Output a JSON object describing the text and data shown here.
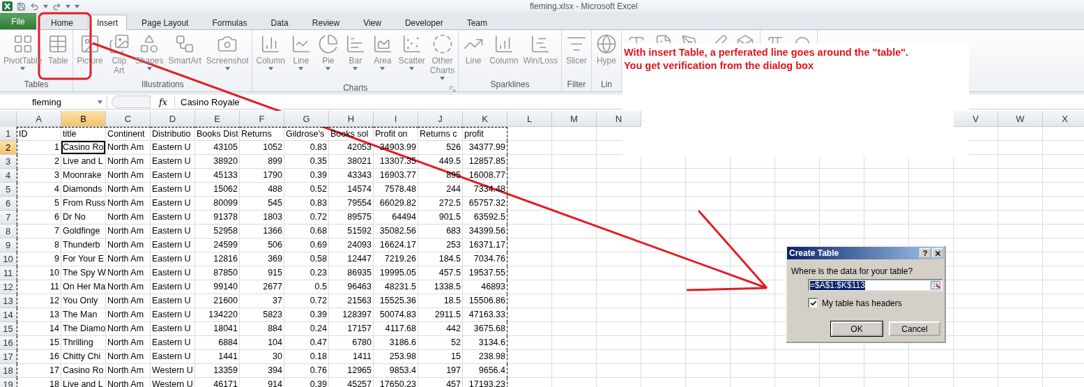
{
  "window": {
    "title": "fleming.xlsx  -  Microsoft Excel"
  },
  "tabs": [
    {
      "label": "File",
      "kind": "file",
      "selected": false
    },
    {
      "label": "Home",
      "kind": "tab",
      "selected": false
    },
    {
      "label": "Insert",
      "kind": "tab",
      "selected": true
    },
    {
      "label": "Page Layout",
      "kind": "tab",
      "selected": false
    },
    {
      "label": "Formulas",
      "kind": "tab",
      "selected": false
    },
    {
      "label": "Data",
      "kind": "tab",
      "selected": false
    },
    {
      "label": "Review",
      "kind": "tab",
      "selected": false
    },
    {
      "label": "View",
      "kind": "tab",
      "selected": false
    },
    {
      "label": "Developer",
      "kind": "tab",
      "selected": false
    },
    {
      "label": "Team",
      "kind": "tab",
      "selected": false
    }
  ],
  "ribbon": {
    "groups": [
      {
        "label": "Tables",
        "items": [
          {
            "label": [
              "PivotTable"
            ],
            "kind": "pivot",
            "dropdown": true
          },
          {
            "label": [
              "Table"
            ],
            "kind": "table",
            "dropdown": false
          }
        ]
      },
      {
        "label": "Illustrations",
        "items": [
          {
            "label": [
              "Picture"
            ],
            "kind": "picture",
            "dropdown": false
          },
          {
            "label": [
              "Clip",
              "Art"
            ],
            "kind": "clipart",
            "dropdown": false
          },
          {
            "label": [
              "Shapes"
            ],
            "kind": "shapes",
            "dropdown": true
          },
          {
            "label": [
              "SmartArt"
            ],
            "kind": "smartart",
            "dropdown": false
          },
          {
            "label": [
              "Screenshot"
            ],
            "kind": "screenshot",
            "dropdown": true
          }
        ]
      },
      {
        "label": "Charts",
        "launcher": true,
        "items": [
          {
            "label": [
              "Column"
            ],
            "kind": "column",
            "dropdown": true
          },
          {
            "label": [
              "Line"
            ],
            "kind": "line",
            "dropdown": true
          },
          {
            "label": [
              "Pie"
            ],
            "kind": "pie",
            "dropdown": true
          },
          {
            "label": [
              "Bar"
            ],
            "kind": "bar",
            "dropdown": true
          },
          {
            "label": [
              "Area"
            ],
            "kind": "area",
            "dropdown": true
          },
          {
            "label": [
              "Scatter"
            ],
            "kind": "scatter",
            "dropdown": true
          },
          {
            "label": [
              "Other",
              "Charts"
            ],
            "kind": "donut",
            "dropdown": true
          }
        ]
      },
      {
        "label": "Sparklines",
        "items": [
          {
            "label": [
              "Line"
            ],
            "kind": "spark-line",
            "dropdown": false
          },
          {
            "label": [
              "Column"
            ],
            "kind": "spark-column",
            "dropdown": false
          },
          {
            "label": [
              "Win/Loss"
            ],
            "kind": "winloss",
            "dropdown": false
          }
        ]
      },
      {
        "label": "Filter",
        "items": [
          {
            "label": [
              "Slicer"
            ],
            "kind": "slicer",
            "dropdown": false
          }
        ]
      },
      {
        "label": "Lin",
        "items": [
          {
            "label": [
              "Hype"
            ],
            "kind": "globe",
            "dropdown": false
          }
        ]
      },
      {
        "items": [
          {
            "kind": "textbox"
          },
          {
            "kind": "header"
          },
          {
            "kind": "wordart"
          },
          {
            "kind": "signature"
          },
          {
            "kind": "object"
          }
        ]
      },
      {
        "items": [
          {
            "kind": "pi"
          },
          {
            "kind": "omega"
          }
        ]
      }
    ]
  },
  "formula_bar": {
    "name_box": "fleming",
    "function_label": "fx",
    "formula": "Casino Royale"
  },
  "sheet": {
    "marquee": true,
    "columns": [
      {
        "label": "A",
        "selected": false
      },
      {
        "label": "B",
        "selected": true
      },
      {
        "label": "C",
        "selected": false
      },
      {
        "label": "D",
        "selected": false
      },
      {
        "label": "E",
        "selected": false
      },
      {
        "label": "F",
        "selected": false
      },
      {
        "label": "G",
        "selected": false
      },
      {
        "label": "H",
        "selected": false
      },
      {
        "label": "I",
        "selected": false
      },
      {
        "label": "J",
        "selected": false
      },
      {
        "label": "K",
        "selected": false
      },
      {
        "label": "L",
        "selected": false
      },
      {
        "label": "M",
        "selected": false
      },
      {
        "label": "N",
        "selected": false
      },
      {
        "label": "V",
        "selected": false
      },
      {
        "label": "W",
        "selected": false
      },
      {
        "label": "X",
        "selected": false
      }
    ],
    "rows": [
      {
        "label": "1",
        "selected": false,
        "cells": [
          "ID",
          "title",
          "Continent",
          "Distributio",
          "Books Dist",
          "Returns",
          "Gildrose's",
          "Books sol",
          "Profit on",
          "Returns c",
          "profit"
        ]
      },
      {
        "label": "2",
        "selected": true,
        "cells": [
          "1",
          "Casino Ro",
          "North Am",
          "Eastern U",
          "43105",
          "1052",
          "0.83",
          "42053",
          "34903.99",
          "526",
          "34377.99"
        ]
      },
      {
        "label": "3",
        "selected": false,
        "cells": [
          "2",
          "Live and L",
          "North Am",
          "Eastern U",
          "38920",
          "899",
          "0.35",
          "38021",
          "13307.35",
          "449.5",
          "12857.85"
        ]
      },
      {
        "label": "4",
        "selected": false,
        "cells": [
          "3",
          "Moonrake",
          "North Am",
          "Eastern U",
          "45133",
          "1790",
          "0.39",
          "43343",
          "16903.77",
          "895",
          "16008.77"
        ]
      },
      {
        "label": "5",
        "selected": false,
        "cells": [
          "4",
          "Diamonds",
          "North Am",
          "Eastern U",
          "15062",
          "488",
          "0.52",
          "14574",
          "7578.48",
          "244",
          "7334.48"
        ]
      },
      {
        "label": "6",
        "selected": false,
        "cells": [
          "5",
          "From Russ",
          "North Am",
          "Eastern U",
          "80099",
          "545",
          "0.83",
          "79554",
          "66029.82",
          "272.5",
          "65757.32"
        ]
      },
      {
        "label": "7",
        "selected": false,
        "cells": [
          "6",
          "Dr No",
          "North Am",
          "Eastern U",
          "91378",
          "1803",
          "0.72",
          "89575",
          "64494",
          "901.5",
          "63592.5"
        ]
      },
      {
        "label": "8",
        "selected": false,
        "cells": [
          "7",
          "Goldfinge",
          "North Am",
          "Eastern U",
          "52958",
          "1366",
          "0.68",
          "51592",
          "35082.56",
          "683",
          "34399.56"
        ]
      },
      {
        "label": "9",
        "selected": false,
        "cells": [
          "8",
          "Thunderb",
          "North Am",
          "Eastern U",
          "24599",
          "506",
          "0.69",
          "24093",
          "16624.17",
          "253",
          "16371.17"
        ]
      },
      {
        "label": "10",
        "selected": false,
        "cells": [
          "9",
          "For Your E",
          "North Am",
          "Eastern U",
          "12816",
          "369",
          "0.58",
          "12447",
          "7219.26",
          "184.5",
          "7034.76"
        ]
      },
      {
        "label": "11",
        "selected": false,
        "cells": [
          "10",
          "The Spy W",
          "North Am",
          "Eastern U",
          "87850",
          "915",
          "0.23",
          "86935",
          "19995.05",
          "457.5",
          "19537.55"
        ]
      },
      {
        "label": "12",
        "selected": false,
        "cells": [
          "11",
          "On Her Ma",
          "North Am",
          "Eastern U",
          "99140",
          "2677",
          "0.5",
          "96463",
          "48231.5",
          "1338.5",
          "46893"
        ]
      },
      {
        "label": "13",
        "selected": false,
        "cells": [
          "12",
          "You Only",
          "North Am",
          "Eastern U",
          "21600",
          "37",
          "0.72",
          "21563",
          "15525.36",
          "18.5",
          "15506.86"
        ]
      },
      {
        "label": "14",
        "selected": false,
        "cells": [
          "13",
          "The Man",
          "North Am",
          "Eastern U",
          "134220",
          "5823",
          "0.39",
          "128397",
          "50074.83",
          "2911.5",
          "47163.33"
        ]
      },
      {
        "label": "15",
        "selected": false,
        "cells": [
          "14",
          "The Diamo",
          "North Am",
          "Eastern U",
          "18041",
          "884",
          "0.24",
          "17157",
          "4117.68",
          "442",
          "3675.68"
        ]
      },
      {
        "label": "16",
        "selected": false,
        "cells": [
          "15",
          "Thrilling",
          "North Am",
          "Eastern U",
          "6884",
          "104",
          "0.47",
          "6780",
          "3186.6",
          "52",
          "3134.6"
        ]
      },
      {
        "label": "17",
        "selected": false,
        "cells": [
          "16",
          "Chitty Chi",
          "North Am",
          "Eastern U",
          "1441",
          "30",
          "0.18",
          "1411",
          "253.98",
          "15",
          "238.98"
        ]
      },
      {
        "label": "18",
        "selected": false,
        "cells": [
          "17",
          "Casino Ro",
          "North Am",
          "Western U",
          "13359",
          "394",
          "0.76",
          "12965",
          "9853.4",
          "197",
          "9656.4"
        ]
      },
      {
        "label": "19",
        "selected": false,
        "cells": [
          "18",
          "Live and L",
          "North Am",
          "Western U",
          "46171",
          "914",
          "0.39",
          "45257",
          "17650.23",
          "457",
          "17193.23"
        ]
      }
    ]
  },
  "annotation": {
    "lines": [
      "With insert Table, a perferated line goes around the \"table\".",
      "You get verification from the dialog box"
    ]
  },
  "dialog": {
    "title": "Create Table",
    "help": "?",
    "prompt": "Where is the data for your table?",
    "range": "=$A$1:$K$113",
    "checkbox": {
      "label": "My table has headers",
      "checked": true
    },
    "buttons": [
      "OK",
      "Cancel"
    ]
  }
}
